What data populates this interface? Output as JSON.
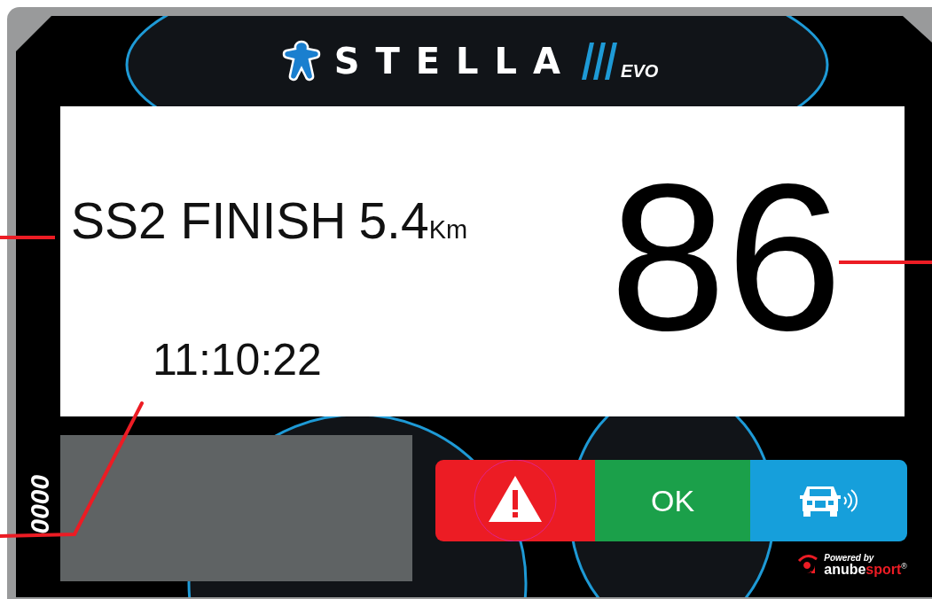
{
  "header": {
    "brand": "STELLA",
    "edition": "EVO"
  },
  "display": {
    "stage": "SS2 FINISH",
    "distance": "5.4",
    "unit": "Km",
    "time": "11:10:22",
    "speed": "86"
  },
  "side_counter": "0000",
  "buttons": [
    {
      "kind": "alert",
      "color": "#ec1c24"
    },
    {
      "kind": "ok",
      "label": "OK",
      "color": "#1ba04a"
    },
    {
      "kind": "vehicle",
      "color": "#169fdb"
    }
  ],
  "footer": {
    "powered_by": "Powered by",
    "brand_parts": [
      "anube",
      "sport"
    ],
    "mark": "®"
  }
}
